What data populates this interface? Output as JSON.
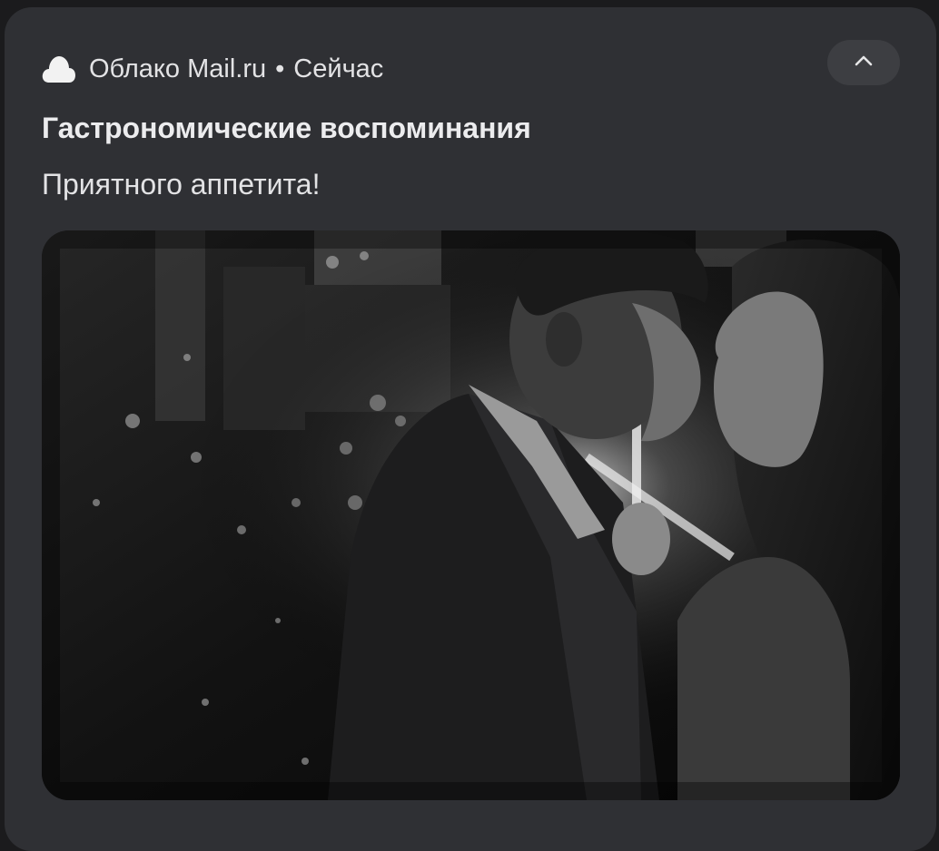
{
  "notification": {
    "app_name": "Облако Mail.ru",
    "separator": "•",
    "time": "Сейчас",
    "title": "Гастрономические воспоминания",
    "text": "Приятного аппетита!",
    "image_description": "Черно-белое фото: пара целуется ночью под зонтом",
    "app_icon": "cloud-icon",
    "collapse_icon": "chevron-up-icon"
  },
  "colors": {
    "card_bg": "#2f3034",
    "page_bg": "#1b1b1d",
    "text_primary": "#ececee",
    "button_bg": "#3d3e42"
  }
}
